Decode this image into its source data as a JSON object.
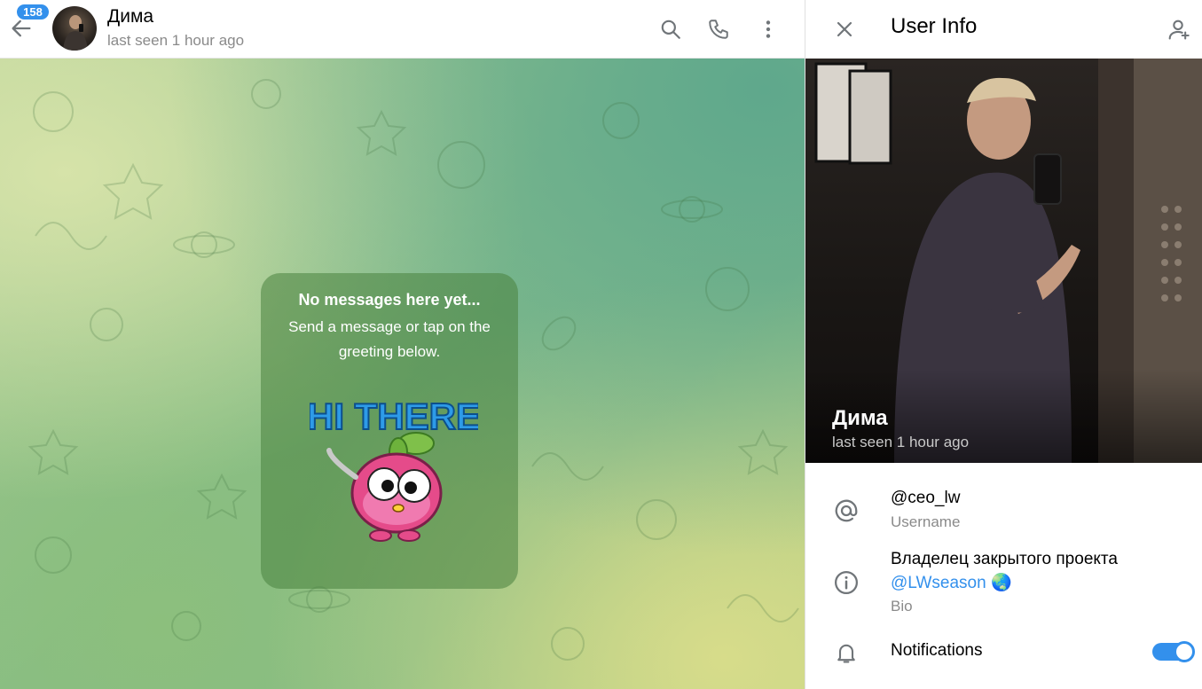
{
  "chat": {
    "unread_count": "158",
    "title": "Дима",
    "status": "last seen 1 hour ago"
  },
  "empty_state": {
    "title": "No messages here yet...",
    "text": "Send a message or tap on the greeting below.",
    "sticker_text": "HI THERE"
  },
  "info_panel": {
    "title": "User Info",
    "name": "Дима",
    "status": "last seen 1 hour ago",
    "username": "@ceo_lw",
    "username_label": "Username",
    "bio_text": "Владелец закрытого проекта",
    "bio_link": "@LWseason",
    "bio_emoji": "🌏",
    "bio_label": "Bio",
    "notifications_label": "Notifications",
    "notifications_enabled": true
  },
  "icons": {
    "back": "arrow-left-icon",
    "search": "search-icon",
    "call": "phone-icon",
    "more": "more-vertical-icon",
    "close": "close-icon",
    "add_contact": "add-contact-icon",
    "username": "at-sign-icon",
    "bio": "info-icon",
    "notifications": "bell-icon"
  },
  "colors": {
    "accent": "#3390ec",
    "secondary_text": "#8a8a8a"
  }
}
